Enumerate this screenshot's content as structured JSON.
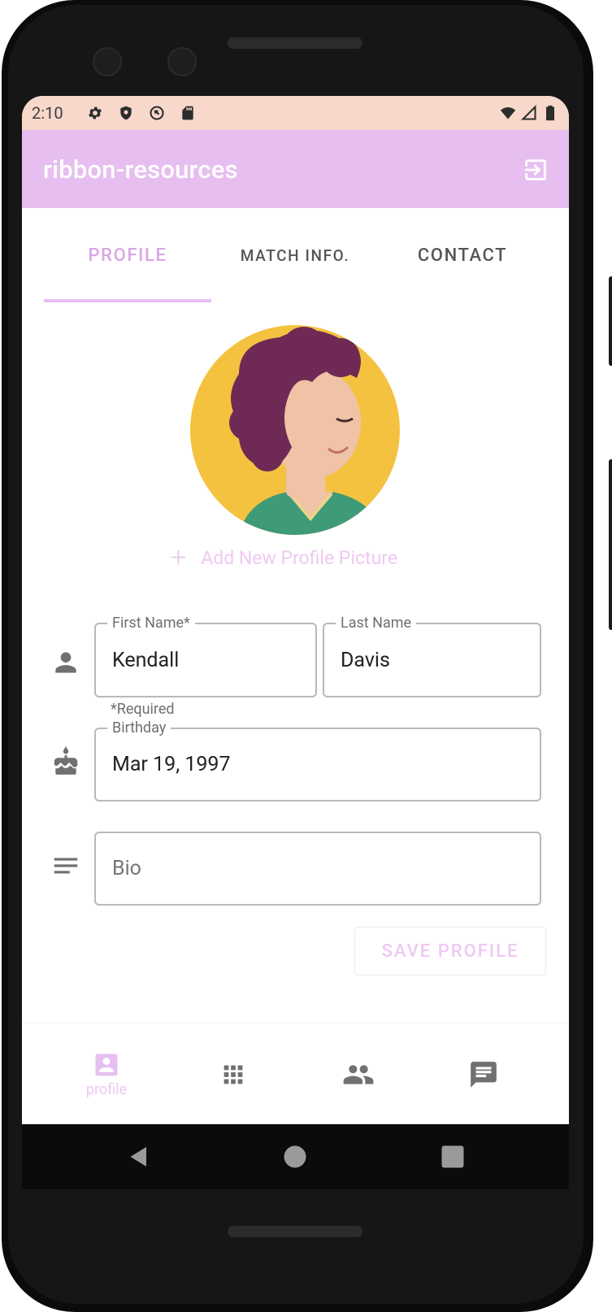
{
  "status_bar": {
    "time": "2:10",
    "background_color": "#f7d8cb",
    "left_icons": [
      "settings-icon",
      "shield-icon",
      "sync-icon",
      "sd-card-icon"
    ],
    "right_icons": [
      "wifi-icon",
      "signal-icon",
      "battery-icon"
    ]
  },
  "app_bar": {
    "title": "ribbon-resources",
    "background_color": "#e6bff0",
    "action_icon": "logout-icon"
  },
  "tabs": [
    {
      "label": "PROFILE",
      "active": true
    },
    {
      "label": "MATCH INFO.",
      "active": false
    },
    {
      "label": "CONTACT",
      "active": false
    }
  ],
  "profile": {
    "avatar_icon": "avatar-illustration",
    "add_picture_label": "Add New Profile Picture"
  },
  "form": {
    "first_name": {
      "label": "First Name*",
      "value": "Kendall"
    },
    "last_name": {
      "label": "Last Name",
      "value": "Davis"
    },
    "required_note": "*Required",
    "birthday": {
      "label": "Birthday",
      "value": "Mar 19, 1997"
    },
    "bio": {
      "placeholder": "Bio",
      "value": ""
    },
    "save_label": "SAVE PROFILE"
  },
  "bottom_nav": {
    "items": [
      {
        "icon": "profile-icon",
        "label": "profile",
        "active": true
      },
      {
        "icon": "grid-icon",
        "label": "",
        "active": false
      },
      {
        "icon": "people-icon",
        "label": "",
        "active": false
      },
      {
        "icon": "chat-icon",
        "label": "",
        "active": false
      }
    ]
  },
  "accent_color": "#e6bff0"
}
